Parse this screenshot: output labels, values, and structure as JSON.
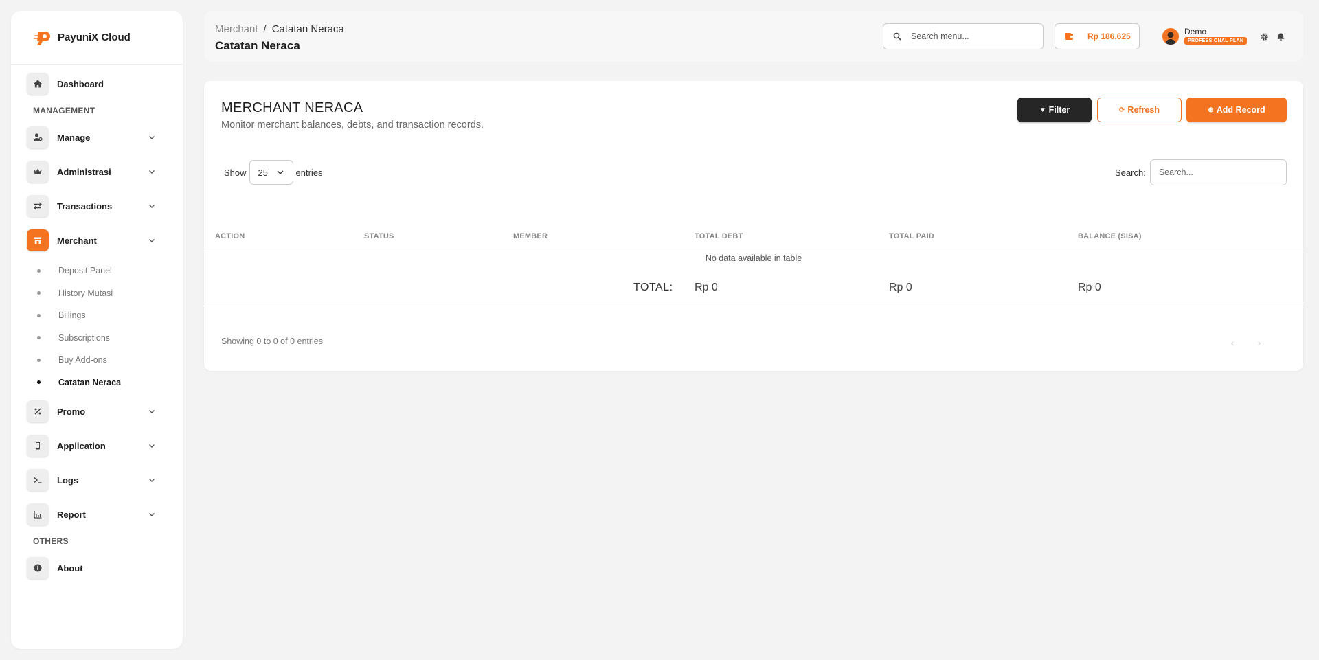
{
  "brand": {
    "name": "PayuniX Cloud"
  },
  "sidebar": {
    "items": [
      {
        "label": "Dashboard",
        "icon": "home-icon"
      },
      {
        "label": "Manage",
        "icon": "user-gear-icon"
      },
      {
        "label": "Administrasi",
        "icon": "crown-icon"
      },
      {
        "label": "Transactions",
        "icon": "arrows-exchange-icon"
      },
      {
        "label": "Merchant",
        "icon": "store-icon"
      },
      {
        "label": "Promo",
        "icon": "percent-icon"
      },
      {
        "label": "Application",
        "icon": "mobile-icon"
      },
      {
        "label": "Logs",
        "icon": "terminal-icon"
      },
      {
        "label": "Report",
        "icon": "bar-chart-icon"
      },
      {
        "label": "About",
        "icon": "info-icon"
      }
    ],
    "sections": {
      "management": "MANAGEMENT",
      "others": "OTHERS"
    },
    "merchant_sub": [
      "Deposit Panel",
      "History Mutasi",
      "Billings",
      "Subscriptions",
      "Buy Add-ons",
      "Catatan Neraca"
    ],
    "active_sub": "Catatan Neraca"
  },
  "topbar": {
    "breadcrumb": {
      "parent": "Merchant",
      "separator": "/",
      "current": "Catatan Neraca"
    },
    "title": "Catatan Neraca",
    "search_placeholder": "Search menu...",
    "wallet_amount": "Rp 186.625",
    "user_name": "Demo",
    "plan": "PROFESSIONAL PLAN"
  },
  "card": {
    "title": "MERCHANT NERACA",
    "subtitle": "Monitor merchant balances, debts, and transaction records.",
    "buttons": {
      "filter": "Filter",
      "refresh": "Refresh",
      "add": "Add Record"
    },
    "show_label": "Show",
    "entries_value": "25",
    "entries_label": "entries",
    "search_label": "Search:",
    "search_placeholder": "Search...",
    "columns": [
      "ACTION",
      "STATUS",
      "MEMBER",
      "TOTAL DEBT",
      "TOTAL PAID",
      "BALANCE (SISA)"
    ],
    "empty_text": "No data available in table",
    "total_label": "TOTAL:",
    "totals": {
      "debt": "Rp 0",
      "paid": "Rp 0",
      "balance": "Rp 0"
    },
    "showing": "Showing 0 to 0 of 0 entries"
  },
  "colors": {
    "accent": "#f47320",
    "dark_button": "#262626"
  }
}
